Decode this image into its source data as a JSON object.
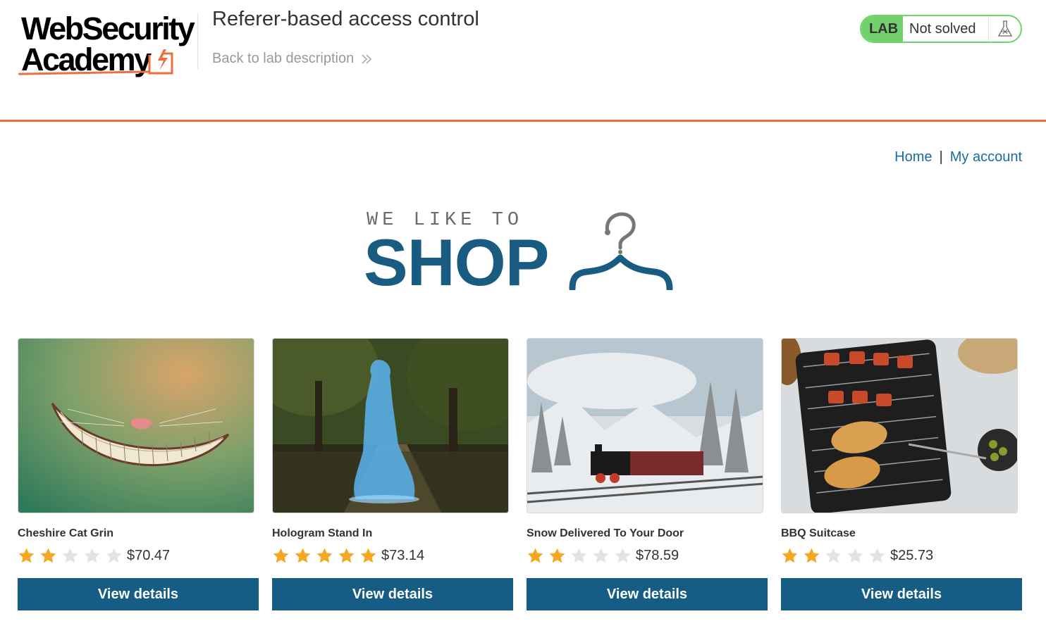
{
  "logo": {
    "line1": "WebSecurity",
    "line2": "Academy"
  },
  "lab": {
    "title": "Referer-based access control",
    "back_link": "Back to lab description",
    "badge": "LAB",
    "status": "Not solved"
  },
  "nav": {
    "home": "Home",
    "separator": "|",
    "my_account": "My account"
  },
  "banner": {
    "small": "WE LIKE TO",
    "big": "SHOP"
  },
  "products": [
    {
      "name": "Cheshire Cat Grin",
      "rating": 2,
      "price": "$70.47",
      "button": "View details"
    },
    {
      "name": "Hologram Stand In",
      "rating": 5,
      "price": "$73.14",
      "button": "View details"
    },
    {
      "name": "Snow Delivered To Your Door",
      "rating": 2,
      "price": "$78.59",
      "button": "View details"
    },
    {
      "name": "BBQ Suitcase",
      "rating": 2,
      "price": "$25.73",
      "button": "View details"
    }
  ],
  "colors": {
    "accent": "#ec6f3e",
    "primary": "#155d84",
    "link": "#1b6b9e",
    "lab_green": "#70d16d",
    "star_filled": "#f5a623",
    "star_empty": "#e3e3e3"
  }
}
